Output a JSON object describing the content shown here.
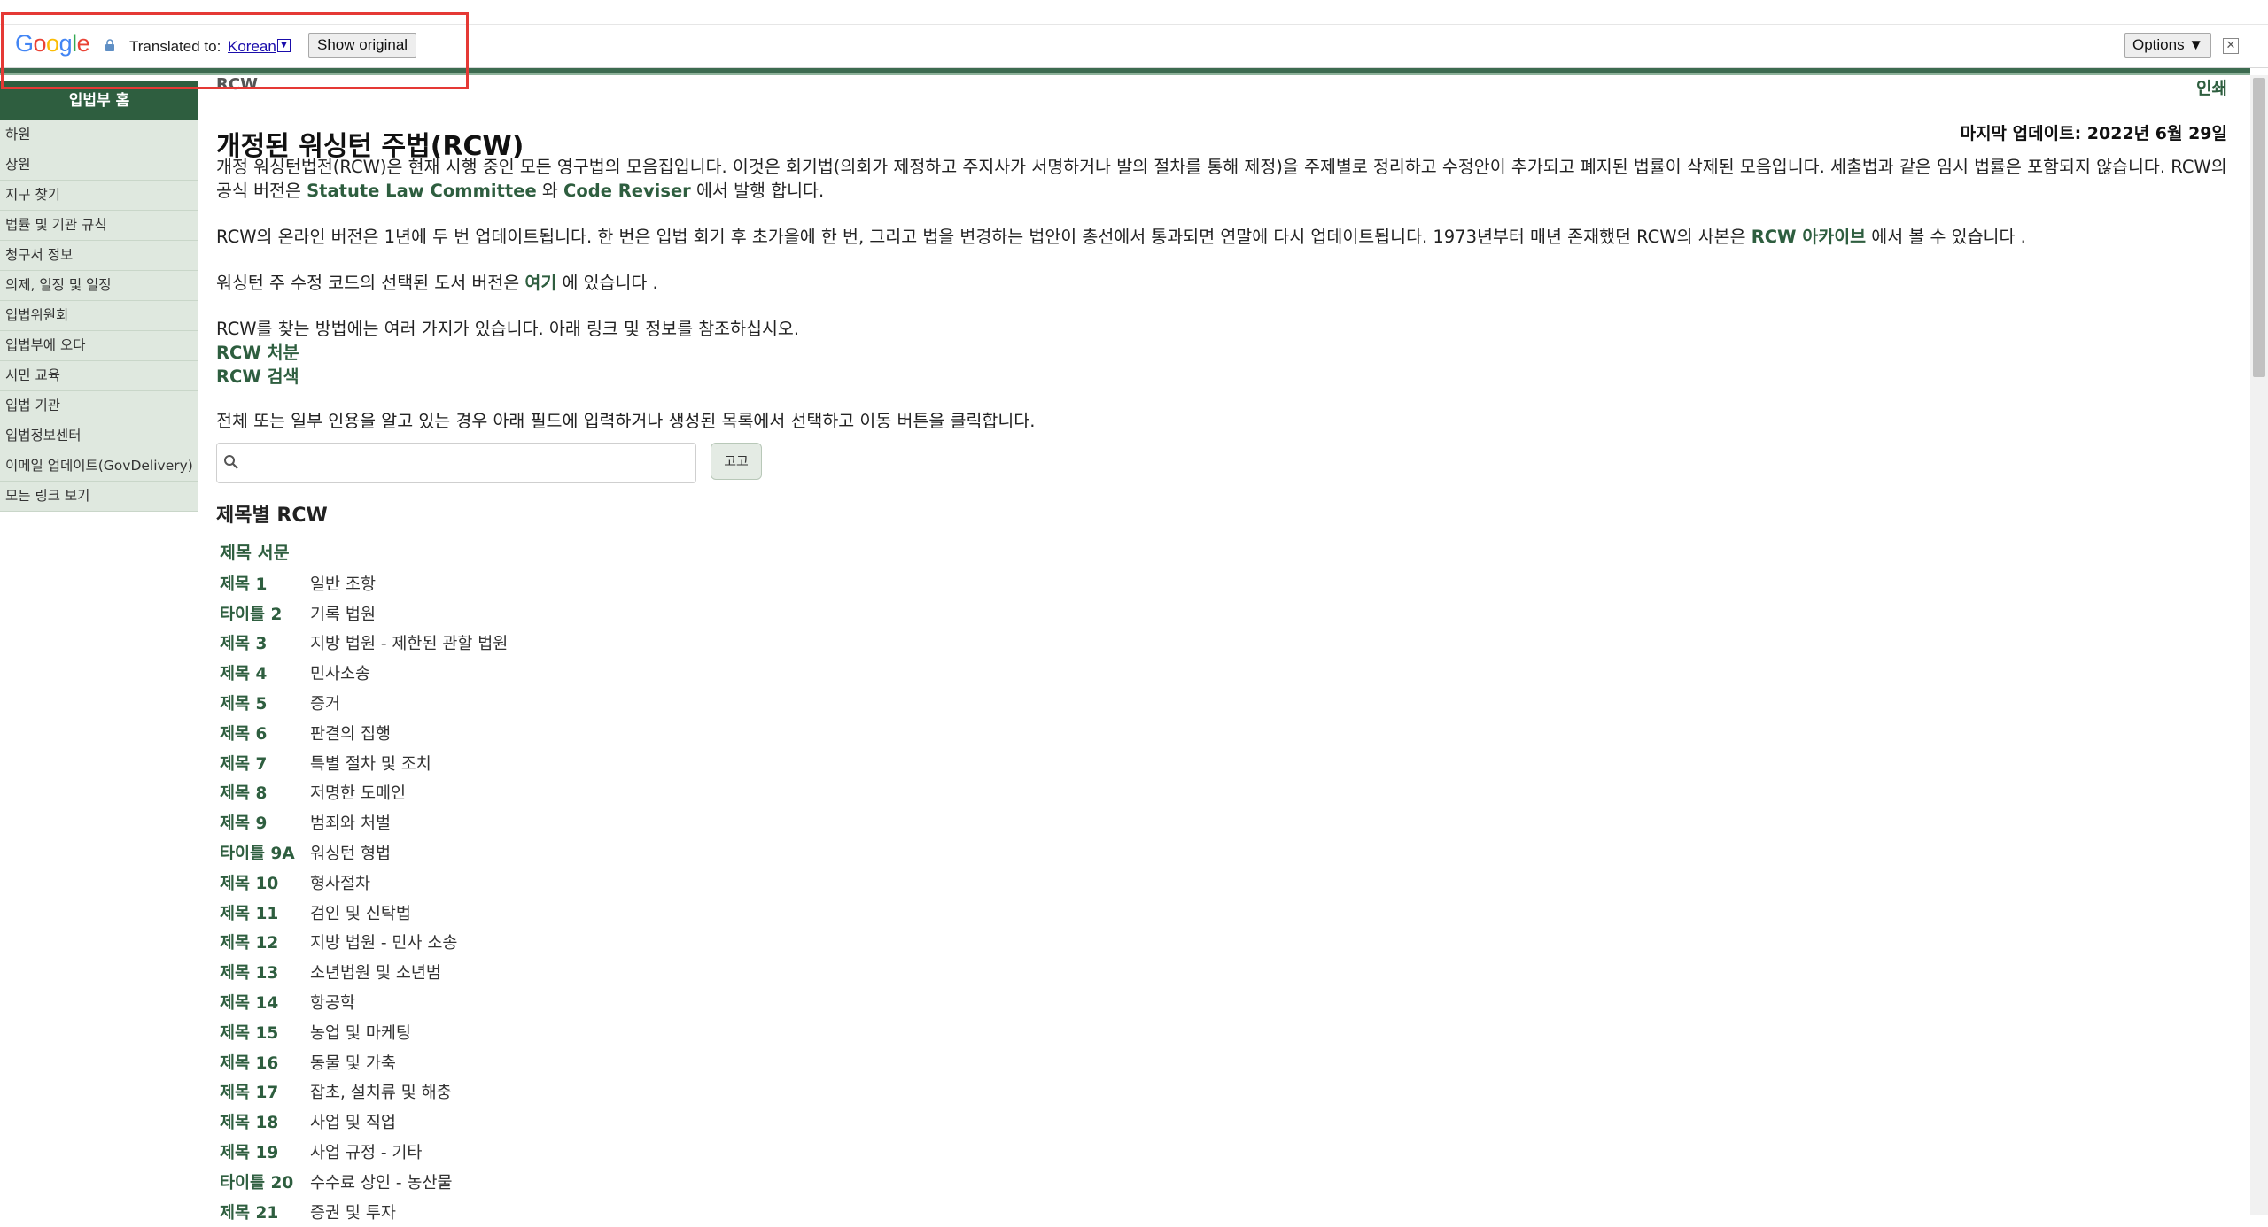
{
  "translate_bar": {
    "logo": "Google",
    "translated_to_label": "Translated to:",
    "language": "Korean",
    "dropdown_glyph": "▼",
    "show_original": "Show original",
    "options": "Options ▼",
    "close_glyph": "✕"
  },
  "sidebar": {
    "header": "입법부 홈",
    "items": [
      "하원",
      "상원",
      "지구 찾기",
      "법률 및 기관 규칙",
      "청구서 정보",
      "의제, 일정 및 일정",
      "입법위원회",
      "입법부에 오다",
      "시민 교육",
      "입법 기관",
      "입법정보센터",
      "이메일 업데이트(GovDelivery)",
      "모든 링크 보기"
    ]
  },
  "main": {
    "breadcrumb": "RCW",
    "print": "인쇄",
    "last_updated": "마지막 업데이트: 2022년 6월 29일",
    "title": "개정된 워싱턴 주법(RCW)",
    "intro": {
      "text_1": "개정 워싱턴법전(RCW)은 현재 시행 중인 모든 영구법의 모음집입니다. 이것은 회기법(의회가 제정하고 주지사가 서명하거나 발의 절차를 통해 제정)을 주제별로 정리하고 수정안이 추가되고 폐지된 법률이 삭제된 모음입니다. 세출법과 같은 임시 법률은 포함되지 않습니다. RCW의 공식 버전은 ",
      "link_1": "Statute Law Committee",
      "text_2": " 와 ",
      "link_2": "Code Reviser",
      "text_3": " 에서 발행 합니다."
    },
    "online": {
      "text_1": "RCW의 온라인 버전은 1년에 두 번 업데이트됩니다. 한 번은 입법 회기 후 초가을에 한 번, 그리고 법을 변경하는 법안이 총선에서 통과되면 연말에 다시 업데이트됩니다. 1973년부터 매년 존재했던 RCW의 사본은 ",
      "link": "RCW 아카이브",
      "text_2": " 에서 볼 수 있습니다 ."
    },
    "print_version": {
      "text_1": "워싱턴 주 수정 코드의 선택된 도서 버전은 ",
      "link": "여기",
      "text_2": " 에 있습니다 ."
    },
    "ways": "RCW를 찾는 방법에는 여러 가지가 있습니다. 아래 링크 및 정보를 참조하십시오.",
    "link_dispositions": "RCW 처분",
    "link_search": "RCW 검색",
    "instruction": "전체 또는 일부 인용을 알고 있는 경우 아래 필드에 입력하거나 생성된 목록에서 선택하고 이동 버튼을 클릭합니다.",
    "search_value": "",
    "go_button": "고고",
    "section_title": "제목별 RCW",
    "preface": "제목 서문",
    "titles": [
      {
        "num": "제목 1",
        "name": "일반 조항"
      },
      {
        "num": "타이틀 2",
        "name": "기록 법원"
      },
      {
        "num": "제목 3",
        "name": "지방 법원 - 제한된 관할 법원"
      },
      {
        "num": "제목 4",
        "name": "민사소송"
      },
      {
        "num": "제목 5",
        "name": "증거"
      },
      {
        "num": "제목 6",
        "name": "판결의 집행"
      },
      {
        "num": "제목 7",
        "name": "특별 절차 및 조치"
      },
      {
        "num": "제목 8",
        "name": "저명한 도메인"
      },
      {
        "num": "제목 9",
        "name": "범죄와 처벌"
      },
      {
        "num": "타이틀 9A",
        "name": "워싱턴 형법"
      },
      {
        "num": "제목 10",
        "name": "형사절차"
      },
      {
        "num": "제목 11",
        "name": "검인 및 신탁법"
      },
      {
        "num": "제목 12",
        "name": "지방 법원 - 민사 소송"
      },
      {
        "num": "제목 13",
        "name": "소년법원 및 소년범"
      },
      {
        "num": "제목 14",
        "name": "항공학"
      },
      {
        "num": "제목 15",
        "name": "농업 및 마케팅"
      },
      {
        "num": "제목 16",
        "name": "동물 및 가축"
      },
      {
        "num": "제목 17",
        "name": "잡초, 설치류 및 해충"
      },
      {
        "num": "제목 18",
        "name": "사업 및 직업"
      },
      {
        "num": "제목 19",
        "name": "사업 규정 - 기타"
      },
      {
        "num": "타이틀 20",
        "name": "수수료 상인 - 농산물"
      },
      {
        "num": "제목 21",
        "name": "증권 및 투자"
      }
    ]
  },
  "colors": {
    "brand_green": "#2e5e3f",
    "sidebar_bg": "#dfe8df",
    "highlight": "#e53935"
  }
}
